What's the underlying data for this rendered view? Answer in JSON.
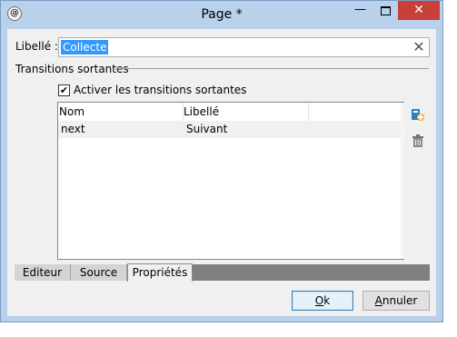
{
  "window": {
    "title": "Page *",
    "minimize_glyph": "—",
    "close_glyph": "✕",
    "app_icon": "app-logo-icon"
  },
  "form": {
    "libelle_label": "Libellé :",
    "libelle_value": "Collecte",
    "clear_icon": "clear-icon"
  },
  "transitions": {
    "group_label": "Transitions sortantes",
    "checkbox_label": "Activer les transitions sortantes",
    "checkbox_checked": true,
    "checkbox_glyph": "✔",
    "columns": [
      "Nom",
      "Libellé"
    ],
    "rows": [
      {
        "nom": "next",
        "libelle": "Suivant"
      }
    ],
    "add_icon": "add-transition-icon",
    "delete_icon": "trash-icon"
  },
  "tabs": [
    {
      "label": "Editeur",
      "active": false
    },
    {
      "label": "Source",
      "active": false
    },
    {
      "label": "Propriétés",
      "active": true
    }
  ],
  "buttons": {
    "ok_accel": "O",
    "ok_rest": "k",
    "cancel_accel": "A",
    "cancel_rest": "nnuler"
  },
  "colors": {
    "frame": "#b9d1ea",
    "close": "#c7403a",
    "selection": "#3399ff"
  }
}
